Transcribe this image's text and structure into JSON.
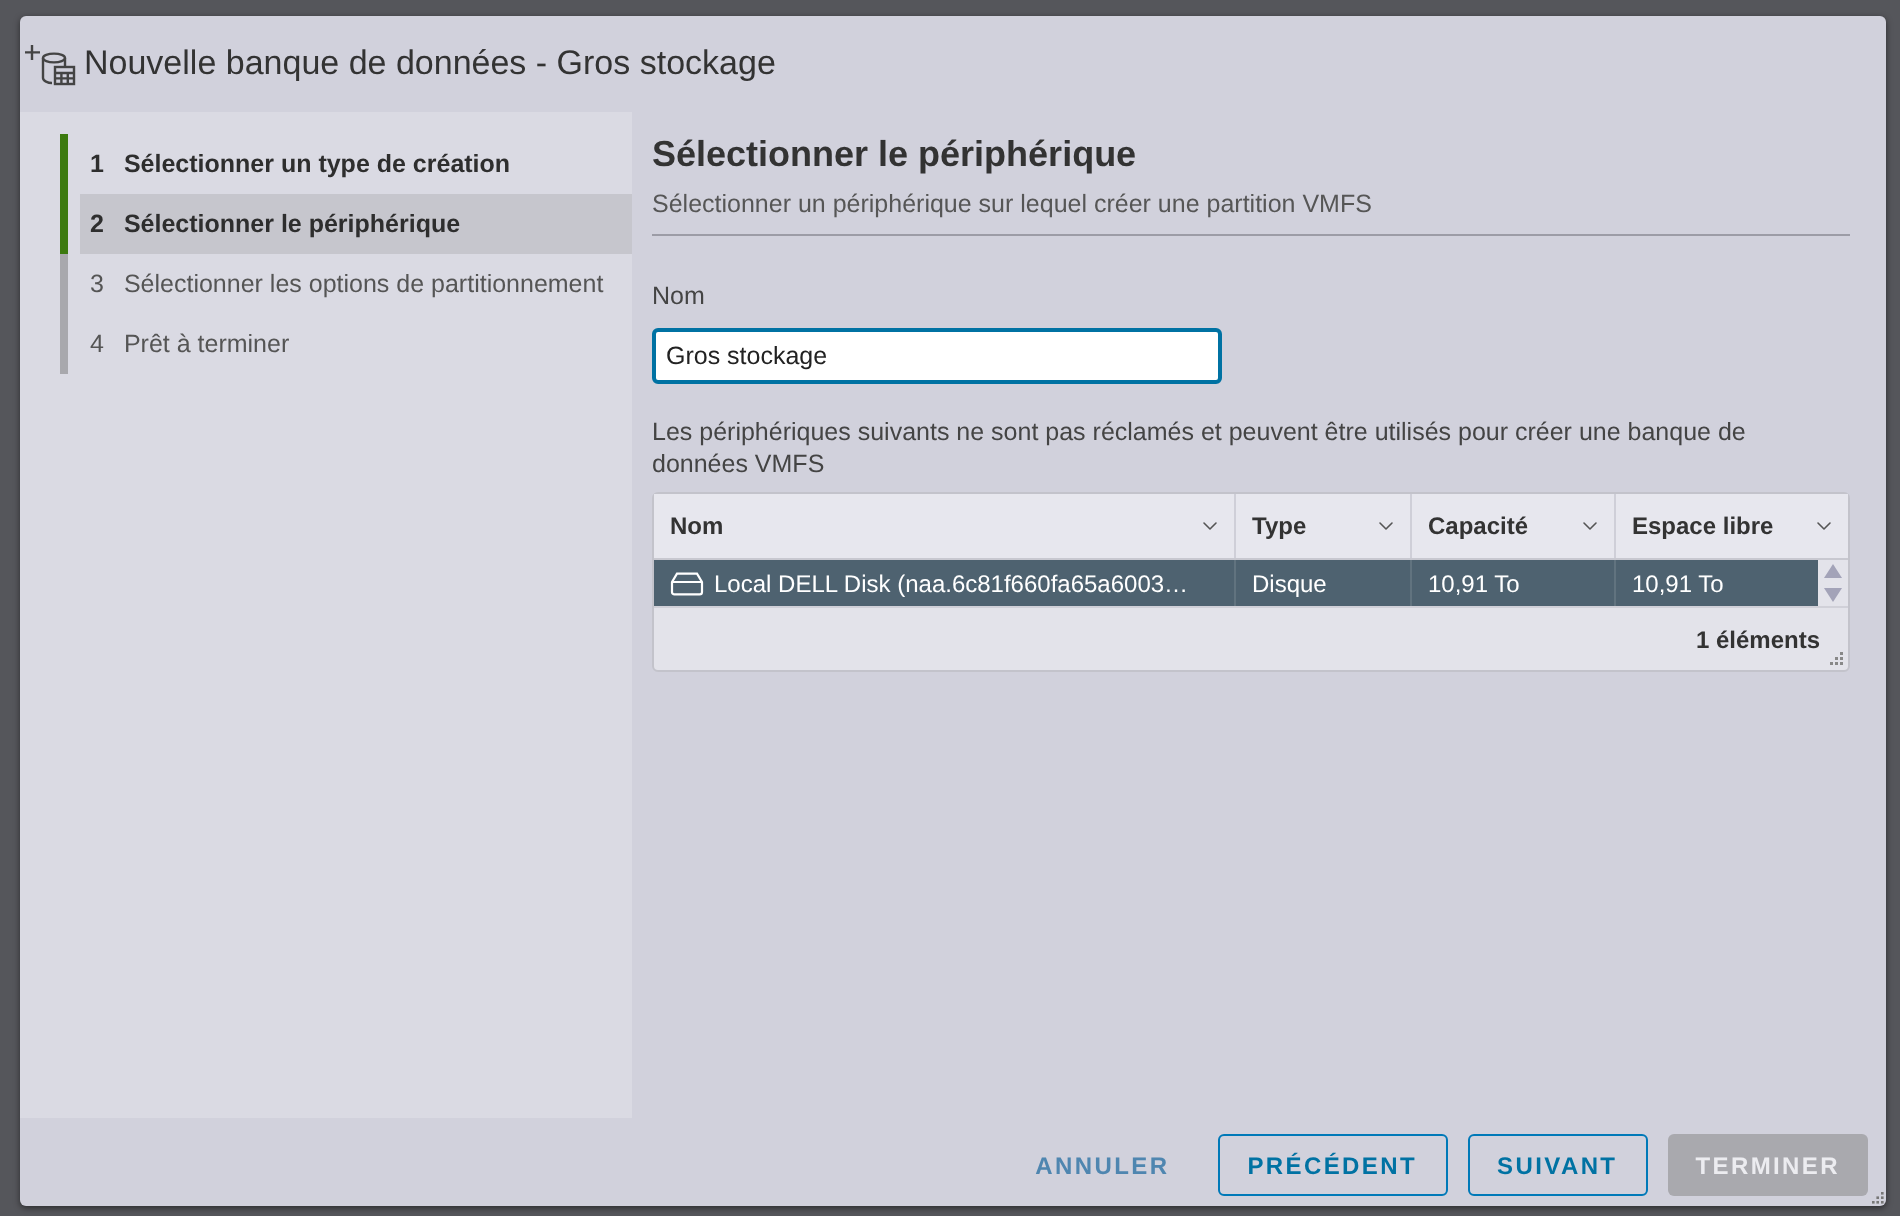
{
  "dialog": {
    "title": "Nouvelle banque de données - Gros stockage"
  },
  "steps": [
    {
      "number": "1",
      "label": "Sélectionner un type de création",
      "completed": true,
      "selected": false
    },
    {
      "number": "2",
      "label": "Sélectionner le périphérique",
      "completed": false,
      "selected": true
    },
    {
      "number": "3",
      "label": "Sélectionner les options de partitionnement",
      "completed": false,
      "selected": false
    },
    {
      "number": "4",
      "label": "Prêt à terminer",
      "completed": false,
      "selected": false
    }
  ],
  "page": {
    "heading": "Sélectionner le périphérique",
    "subtitle": "Sélectionner un périphérique sur lequel créer une partition VMFS"
  },
  "name_field": {
    "label": "Nom",
    "value": "Gros stockage",
    "focused": true
  },
  "description": "Les périphériques suivants ne sont pas réclamés et peuvent être utilisés pour créer une banque de données VMFS",
  "table": {
    "columns": [
      "Nom",
      "Type",
      "Capacité",
      "Espace libre"
    ],
    "rows": [
      {
        "cells": [
          "Local DELL Disk (naa.6c81f660fa65a6003…",
          "Disque",
          "10,91 To",
          "10,91 To"
        ],
        "selected": true
      }
    ],
    "footer": "1 éléments"
  },
  "buttons": [
    {
      "label": "ANNULER",
      "kind": "flat",
      "disabled": false
    },
    {
      "label": "PRÉCÉDENT",
      "kind": "outline",
      "disabled": false
    },
    {
      "label": "SUIVANT",
      "kind": "outline",
      "disabled": false
    },
    {
      "label": "TERMINER",
      "kind": "solid",
      "disabled": true
    }
  ]
}
